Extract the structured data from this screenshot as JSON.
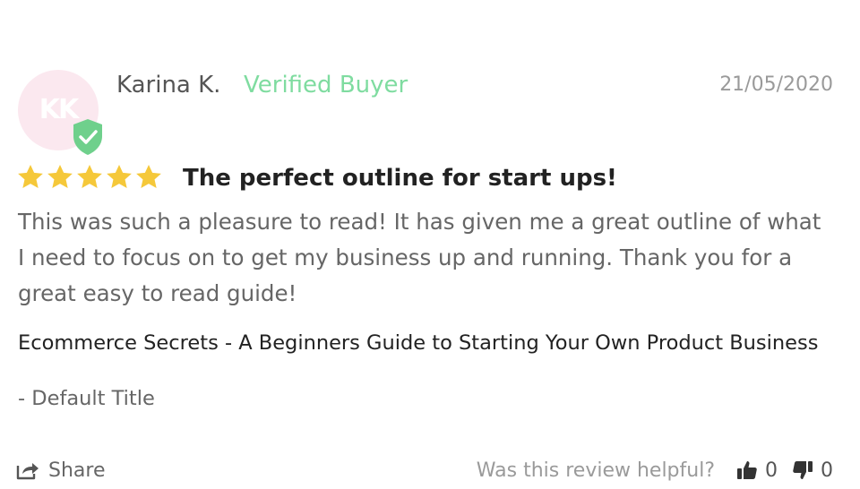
{
  "review": {
    "avatar_initials": "KK",
    "reviewer_name": "Karina K.",
    "verified_label": "Verified Buyer",
    "date": "21/05/2020",
    "rating": 5,
    "rating_max": 5,
    "title": "The perfect outline for start ups!",
    "body": "This was such a pleasure to read! It has given me a great outline of what I need to focus on to get my business up and running. Thank you for a great easy to read guide!",
    "product_name": "Ecommerce Secrets - A Beginners Guide to Starting Your Own Product Business",
    "variant": "- Default Title"
  },
  "footer": {
    "share_label": "Share",
    "helpful_question": "Was this review helpful?",
    "upvotes": "0",
    "downvotes": "0"
  },
  "colors": {
    "verified_green": "#7fdca0",
    "badge_green": "#6fd08c",
    "star_gold": "#f5c83a",
    "avatar_bg": "#fbe8ef"
  },
  "icons": {
    "verified": "shield-check-icon",
    "star": "star-icon",
    "share": "share-icon",
    "thumbs_up": "thumbs-up-icon",
    "thumbs_down": "thumbs-down-icon"
  }
}
